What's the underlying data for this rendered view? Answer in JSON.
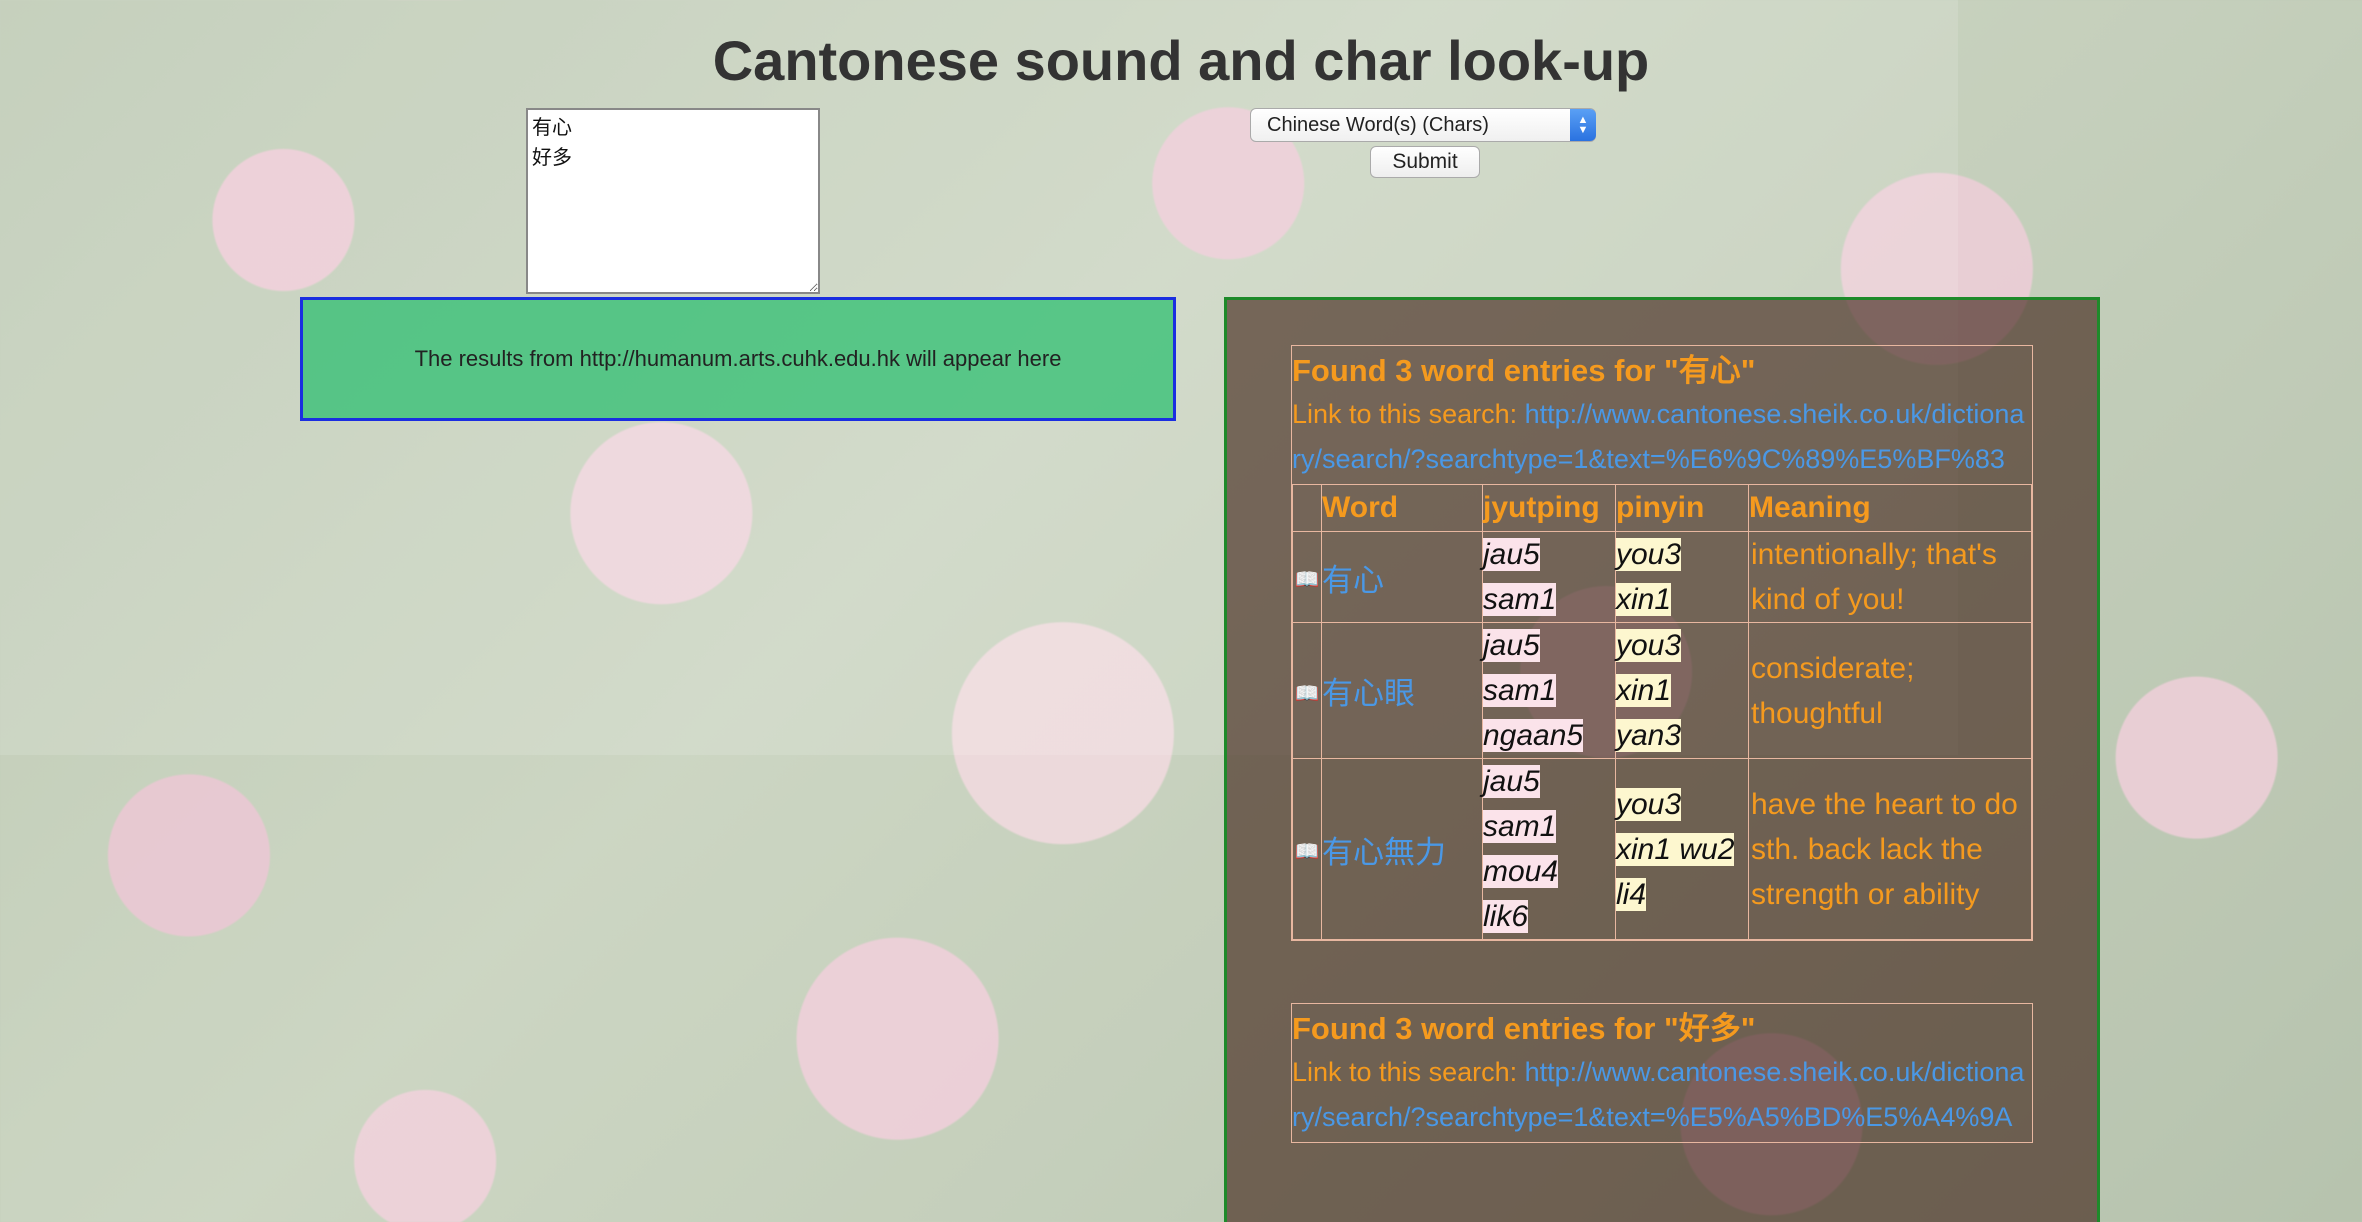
{
  "header": {
    "title": "Cantonese sound and char look-up"
  },
  "input": {
    "value": "有心\n好多"
  },
  "mode_select": {
    "selected": "Chinese Word(s) (Chars)"
  },
  "submit": {
    "label": "Submit"
  },
  "left_panel": {
    "message": "The results from http://humanum.arts.cuhk.edu.hk will appear here"
  },
  "results": [
    {
      "title": "Found 3 word entries for \"有心\"",
      "link_prefix": "Link to this search: ",
      "link": "http://www.cantonese.sheik.co.uk/dictionary/search/?searchtype=1&text=%E6%9C%89%E5%BF%83",
      "columns": [
        "Word",
        "jyutping",
        "pinyin",
        "Meaning"
      ],
      "rows": [
        {
          "word": "有心",
          "jyutping": [
            "jau5",
            "sam1"
          ],
          "pinyin": [
            "you3",
            "xin1"
          ],
          "meaning": " intentionally; that's kind of you!"
        },
        {
          "word": "有心眼",
          "jyutping": [
            "jau5",
            "sam1",
            "ngaan5"
          ],
          "pinyin": [
            "you3",
            "xin1",
            "yan3"
          ],
          "meaning": " considerate; thoughtful"
        },
        {
          "word": "有心無力",
          "jyutping": [
            "jau5",
            "sam1",
            "mou4",
            "lik6"
          ],
          "pinyin": [
            "you3",
            "xin1 wu2",
            "li4"
          ],
          "meaning": " have the heart to do sth. back lack the strength or ability"
        }
      ]
    },
    {
      "title": "Found 3 word entries for \"好多\"",
      "link_prefix": "Link to this search: ",
      "link": "http://www.cantonese.sheik.co.uk/dictionary/search/?searchtype=1&text=%E5%A5%BD%E5%A4%9A",
      "columns": [],
      "rows": []
    }
  ],
  "icons": {
    "entry": "book-icon",
    "select": "chevron-updown-icon"
  },
  "colors": {
    "title_orange": "#f59a1e",
    "link_blue": "#4a98e6",
    "left_border": "#1a2ee0",
    "right_border": "#1e8a2a",
    "left_bg": "#28be6e"
  }
}
